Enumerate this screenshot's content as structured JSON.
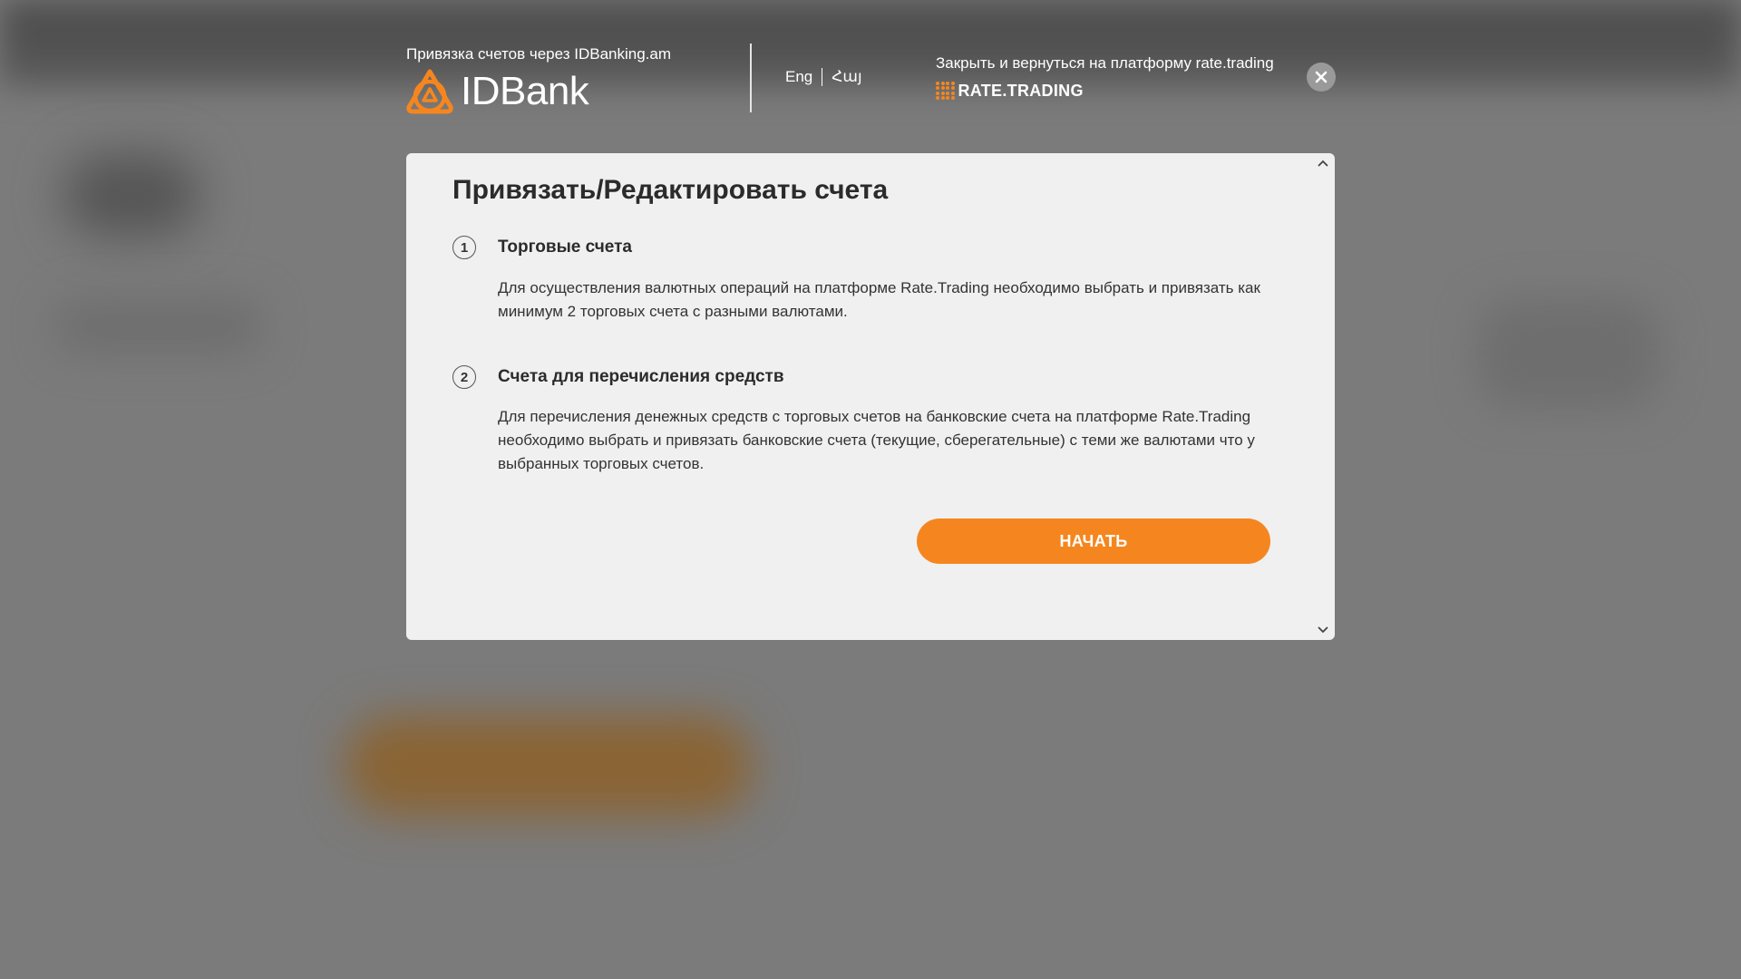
{
  "header": {
    "subtitle": "Привязка счетов через IDBanking.am",
    "brand_name": "IDBank",
    "languages": [
      "Eng",
      "Հայ"
    ],
    "close_text": "Закрыть и вернуться на платформу rate.trading",
    "partner_logo_text": "RATE.TRADING"
  },
  "modal": {
    "title": "Привязать/Редактировать счета",
    "steps": [
      {
        "number": "1",
        "title": "Торговые счета",
        "text": "Для осуществления валютных операций на платформе Rate.Trading необходимо выбрать и привязать как минимум 2 торговых счета с разными валютами."
      },
      {
        "number": "2",
        "title": "Счета для перечисления средств",
        "text": "Для перечисления денежных средств с торговых счетов на банковские счета на платформе Rate.Trading необходимо выбрать и привязать банковские счета (текущие, сберегательные) с теми же валютами что у выбранных торговых счетов."
      }
    ],
    "start_label": "НАЧАТЬ"
  },
  "colors": {
    "accent": "#f5861f",
    "overlay": "#7b7b7b",
    "modal_bg": "#f0f0f0",
    "text_dark": "#2b2b2b"
  },
  "icons": {
    "brand": "idbank-logo-icon",
    "partner": "rate-trading-dots-icon",
    "close": "close-icon",
    "scroll_up": "chevron-up-icon",
    "scroll_down": "chevron-down-icon"
  }
}
